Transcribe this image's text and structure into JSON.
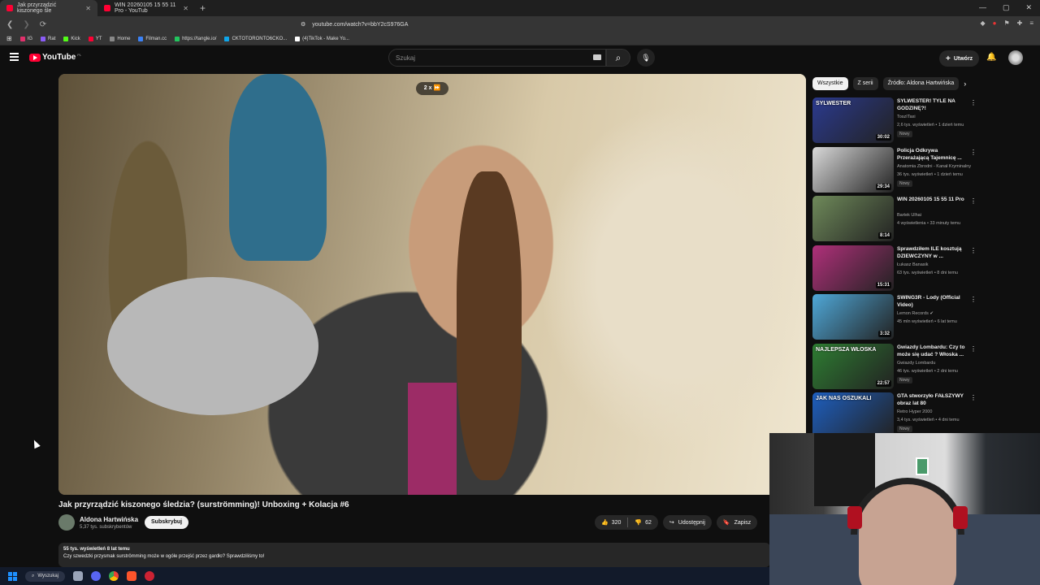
{
  "browser": {
    "tabs": [
      {
        "label": "Jak przyrządzić kiszonego śle"
      },
      {
        "label": "WIN 20260105 15 55 11 Pro - YouTub"
      }
    ],
    "url": "youtube.com/watch?v=bbY2cS976GA",
    "bookmarks": [
      {
        "label": "IG",
        "color": "#e1306c"
      },
      {
        "label": "Rat",
        "color": "#8a5cf6"
      },
      {
        "label": "Kick",
        "color": "#53fc18"
      },
      {
        "label": "YT",
        "color": "#ff0033"
      },
      {
        "label": "Home",
        "color": "#888888"
      },
      {
        "label": "Filman.cc",
        "color": "#3b82f6"
      },
      {
        "label": "https://tangle.io/",
        "color": "#22c55e"
      },
      {
        "label": "CKTOTORONTO6CKO...",
        "color": "#0ea5e9"
      },
      {
        "label": "(4)TikTok - Make Yo...",
        "color": "#ffffff"
      }
    ]
  },
  "header": {
    "logo_text": "YouTube",
    "logo_region": "PL",
    "search_placeholder": "Szukaj",
    "create_label": "Utwórz"
  },
  "player": {
    "speed_label": "2 x ⏩"
  },
  "video": {
    "title": "Jak przyrządzić kiszonego śledzia? (surströmming)! Unboxing + Kolacja #6",
    "channel": "Aldona Hartwińska",
    "subscribers": "5,37 tys. subskrybentów",
    "subscribe_label": "Subskrybuj",
    "likes": "320",
    "dislikes": "62",
    "share_label": "Udostępnij",
    "save_label": "Zapisz",
    "description_meta": "55 tys. wyświetleń  8 lat temu",
    "description_text": "Czy szwedzki przysmak surströmming może w ogóle przejść przez gardło? Sprawdziliśmy to!"
  },
  "filter_chips": [
    "Wszystkie",
    "Z serii",
    "Źródło: Aldona Hartwińska"
  ],
  "recommendations": [
    {
      "title": "SYLWESTER! TYLE NA GODZINĘ?!",
      "channel": "ToszITaxi",
      "stats": "2,6 tys. wyświetleń • 1 dzień temu",
      "badge": "Nowy",
      "duration": "30:02",
      "thumb_text": "SYLWESTER",
      "thumb_color": "#2b3a8f"
    },
    {
      "title": "Policja Odkrywa Przerażającą Tajemnicę ...",
      "channel": "Anatomia Zbrodni - Kanał Kryminalny",
      "stats": "36 tys. wyświetleń • 1 dzień temu",
      "badge": "Nowy",
      "duration": "29:34",
      "thumb_text": "",
      "thumb_color": "#d9d9d9"
    },
    {
      "title": "WIN 20260105 15 55 11 Pro",
      "channel": "Bartek Ulhai",
      "stats": "4 wyświetlenia • 33 minuty temu",
      "badge": "",
      "duration": "8:14",
      "thumb_text": "",
      "thumb_color": "#6f8a5a"
    },
    {
      "title": "Sprawdziłem ILE kosztują DZIEWCZYNY w ...",
      "channel": "Łukasz Banasik",
      "stats": "63 tys. wyświetleń • 8 dni temu",
      "badge": "",
      "duration": "15:31",
      "thumb_text": "",
      "thumb_color": "#b0307a"
    },
    {
      "title": "SWING3R - Lody (Official Video)",
      "channel": "Lemon Records ✔",
      "stats": "45 mln wyświetleń • 6 lat temu",
      "badge": "",
      "duration": "3:32",
      "thumb_text": "",
      "thumb_color": "#4fa8d8"
    },
    {
      "title": "Gwiazdy Lombardu: Czy to może się udać ? Włoska ...",
      "channel": "Gwiazdy Lombardu",
      "stats": "46 tys. wyświetleń • 2 dni temu",
      "badge": "Nowy",
      "duration": "22:57",
      "thumb_text": "NAJLEPSZA WŁOSKA",
      "thumb_color": "#2e7d32"
    },
    {
      "title": "GTA stworzyło FAŁSZYWY obraz lat 80",
      "channel": "Retro Hyper 2000",
      "stats": "3,4 tys. wyświetleń • 4 dni temu",
      "badge": "Nowy",
      "duration": "",
      "thumb_text": "JAK NAS OSZUKALI",
      "thumb_color": "#1e5fbf"
    }
  ],
  "taskbar": {
    "search_label": "Wyszukaj"
  }
}
